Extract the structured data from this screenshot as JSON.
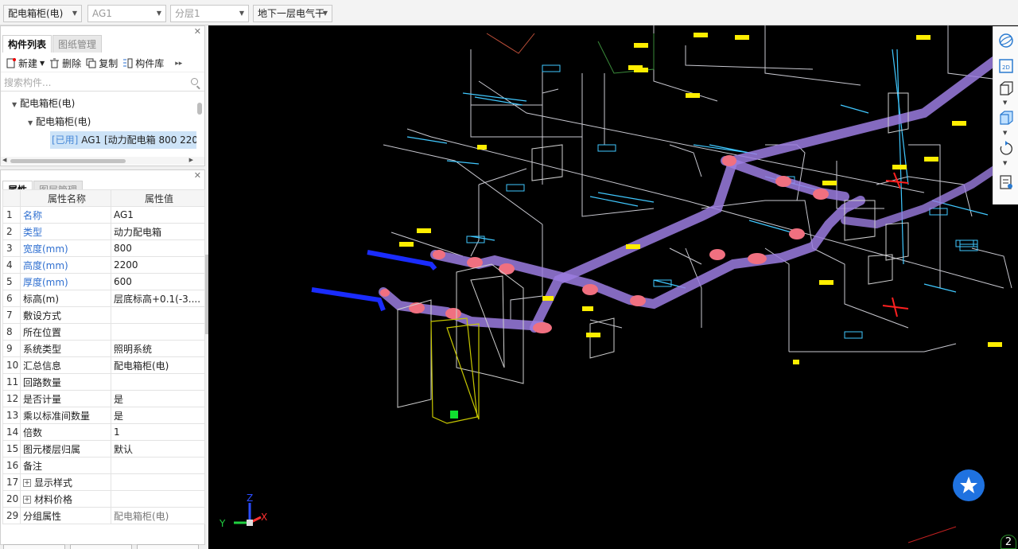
{
  "toolbar": {
    "combos": [
      {
        "value": "配电箱柜(电)"
      },
      {
        "value": "AG1"
      },
      {
        "value": "分层1"
      },
      {
        "value": "地下一层电气干"
      }
    ]
  },
  "component_panel": {
    "tabs": [
      "构件列表",
      "图纸管理"
    ],
    "actions": {
      "new": "新建",
      "delete": "删除",
      "copy": "复制",
      "library": "构件库"
    },
    "search_placeholder": "搜索构件...",
    "tree": {
      "root": "配电箱柜(电)",
      "child": "配电箱柜(电)",
      "selected_tag": "[已用]",
      "selected_label": "AG1 [动力配电箱 800 220"
    }
  },
  "property_panel": {
    "tabs": [
      "属性",
      "图层管理"
    ],
    "header": {
      "name": "属性名称",
      "value": "属性值"
    },
    "rows": [
      {
        "idx": "1",
        "name": "名称",
        "value": "AG1",
        "blue": true
      },
      {
        "idx": "2",
        "name": "类型",
        "value": "动力配电箱",
        "blue": true
      },
      {
        "idx": "3",
        "name": "宽度(mm)",
        "value": "800",
        "blue": true
      },
      {
        "idx": "4",
        "name": "高度(mm)",
        "value": "2200",
        "blue": true
      },
      {
        "idx": "5",
        "name": "厚度(mm)",
        "value": "600",
        "blue": true
      },
      {
        "idx": "6",
        "name": "标高(m)",
        "value": "层底标高+0.1(-3....",
        "blue": false
      },
      {
        "idx": "7",
        "name": "敷设方式",
        "value": "",
        "blue": false
      },
      {
        "idx": "8",
        "name": "所在位置",
        "value": "",
        "blue": false
      },
      {
        "idx": "9",
        "name": "系统类型",
        "value": "照明系统",
        "blue": false
      },
      {
        "idx": "10",
        "name": "汇总信息",
        "value": "配电箱柜(电)",
        "blue": false
      },
      {
        "idx": "11",
        "name": "回路数量",
        "value": "",
        "blue": false
      },
      {
        "idx": "12",
        "name": "是否计量",
        "value": "是",
        "blue": false
      },
      {
        "idx": "13",
        "name": "乘以标准间数量",
        "value": "是",
        "blue": false
      },
      {
        "idx": "14",
        "name": "倍数",
        "value": "1",
        "blue": false
      },
      {
        "idx": "15",
        "name": "图元楼层归属",
        "value": "默认",
        "blue": false
      },
      {
        "idx": "16",
        "name": "备注",
        "value": "",
        "blue": false
      },
      {
        "idx": "17",
        "name": "显示样式",
        "value": "",
        "blue": false,
        "expand": true
      },
      {
        "idx": "20",
        "name": "材料价格",
        "value": "",
        "blue": false,
        "expand": true
      },
      {
        "idx": "29",
        "name": "分组属性",
        "value": "配电箱柜(电)",
        "blue": false,
        "muted": true
      }
    ]
  },
  "viewport": {
    "axis": {
      "x": "X",
      "y": "Y",
      "z": "Z"
    },
    "badge": "2",
    "view_tools": [
      "orbit-icon",
      "2d-view-icon",
      "3d-box-icon",
      "3d-solid-icon",
      "rotate-icon",
      "layer-view-icon"
    ],
    "colors": {
      "pipe": "#a080e0",
      "pipe_joint": "#f07080",
      "blue_pipe": "#1a2cff",
      "cyan": "#40c8ff",
      "yellow": "#ffee00",
      "red": "#ff2020"
    }
  }
}
